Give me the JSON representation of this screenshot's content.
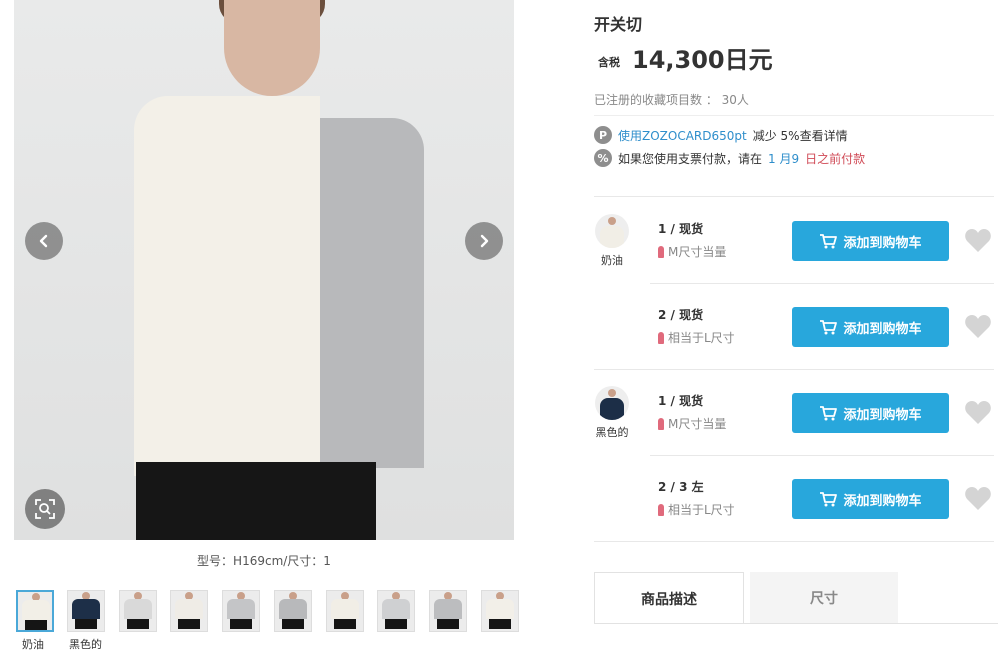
{
  "gallery": {
    "model_info": "型号：H169cm/尺寸：1",
    "prev_icon": "chevron-left-icon",
    "next_icon": "chevron-right-icon",
    "zoom_icon": "zoom-icon",
    "thumbnails": [
      {
        "label": "奶油",
        "top": "#f2efe7",
        "active": true
      },
      {
        "label": "黑色的",
        "top": "#1d2f48",
        "active": false
      },
      {
        "label": "",
        "top": "#d9d9d9",
        "active": false
      },
      {
        "label": "",
        "top": "#efece6",
        "active": false
      },
      {
        "label": "",
        "top": "#c4c5c7",
        "active": false
      },
      {
        "label": "",
        "top": "#b8b9bb",
        "active": false
      },
      {
        "label": "",
        "top": "#f1eee6",
        "active": false
      },
      {
        "label": "",
        "top": "#cfd0d2",
        "active": false
      },
      {
        "label": "",
        "top": "#bcbdbf",
        "active": false
      },
      {
        "label": "",
        "top": "#f2efe8",
        "active": false
      }
    ]
  },
  "product": {
    "title": "开关切",
    "price_prefix": "含税",
    "price": "14,300日元",
    "favorites": "已注册的收藏项目数 ： 30人"
  },
  "promos": {
    "zozocard_icon": "P",
    "zozocard_link": "使用ZOZOCARD650pt",
    "zozocard_text": "减少 5%查看详情",
    "bill_icon": "%",
    "bill_text": "如果您使用支票付款，请在",
    "bill_date_month": "1 月9",
    "bill_date_rest": "日之前付款"
  },
  "variants": [
    {
      "color_label": "奶油",
      "swatch": "#f1eee6",
      "sizes": [
        {
          "stock": "1 / 现货",
          "note": "M尺寸当量",
          "cart_label": "添加到购物车"
        },
        {
          "stock": "2 / 现货",
          "note": "相当于L尺寸",
          "cart_label": "添加到购物车"
        }
      ]
    },
    {
      "color_label": "黑色的",
      "swatch": "#1c2e47",
      "sizes": [
        {
          "stock": "1 / 现货",
          "note": "M尺寸当量",
          "cart_label": "添加到购物车"
        },
        {
          "stock": "2 / 3 左",
          "note": "相当于L尺寸",
          "cart_label": "添加到购物车"
        }
      ]
    }
  ],
  "tabs": {
    "description": "商品描述",
    "size": "尺寸"
  },
  "colors": {
    "accent": "#28a7dc",
    "link": "#2e8ecb",
    "highlight": "#d04a56"
  }
}
